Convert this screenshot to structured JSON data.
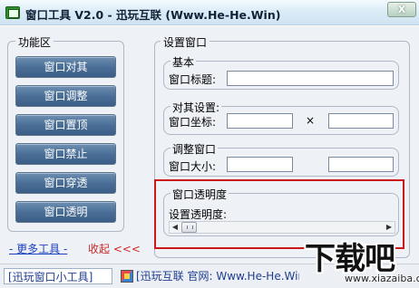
{
  "window": {
    "title": "窗口工具 V2.0 - 迅玩互联 (Www.He-He.Win)",
    "close_label": "X"
  },
  "function_area": {
    "title": "功能区",
    "buttons": [
      {
        "label": "窗口对其"
      },
      {
        "label": "窗口调整"
      },
      {
        "label": "窗口置顶"
      },
      {
        "label": "窗口禁止"
      },
      {
        "label": "窗口穿透"
      },
      {
        "label": "窗口透明"
      }
    ],
    "more_tools_link": "- 更多工具 -",
    "collapse_link": "收起 <<<"
  },
  "settings": {
    "title": "设置窗口",
    "basic": {
      "title": "基本",
      "window_title_label": "窗口标题:",
      "window_title_value": ""
    },
    "align": {
      "title": "对其设置:",
      "coords_label": "窗口坐标:",
      "x_value": "",
      "times": "×",
      "y_value": ""
    },
    "resize": {
      "title": "调整窗口",
      "size_label": "窗口大小:",
      "width_value": "",
      "times": "×",
      "height_value": ""
    },
    "transparency": {
      "title": "窗口透明度",
      "label": "设置透明度:",
      "slider_value": 0
    }
  },
  "statusbar": {
    "left_text": "[迅玩窗口小工具]",
    "right_text": "[迅玩互联 官网: Www.He-He.Win"
  },
  "watermark": {
    "big": "下载吧",
    "small": "www.xiazaiba.com"
  },
  "colors": {
    "button_bg": "#4a6e96",
    "link_blue": "#1a3fbf",
    "link_red": "#cc2a2a",
    "highlight": "#cc1818"
  }
}
